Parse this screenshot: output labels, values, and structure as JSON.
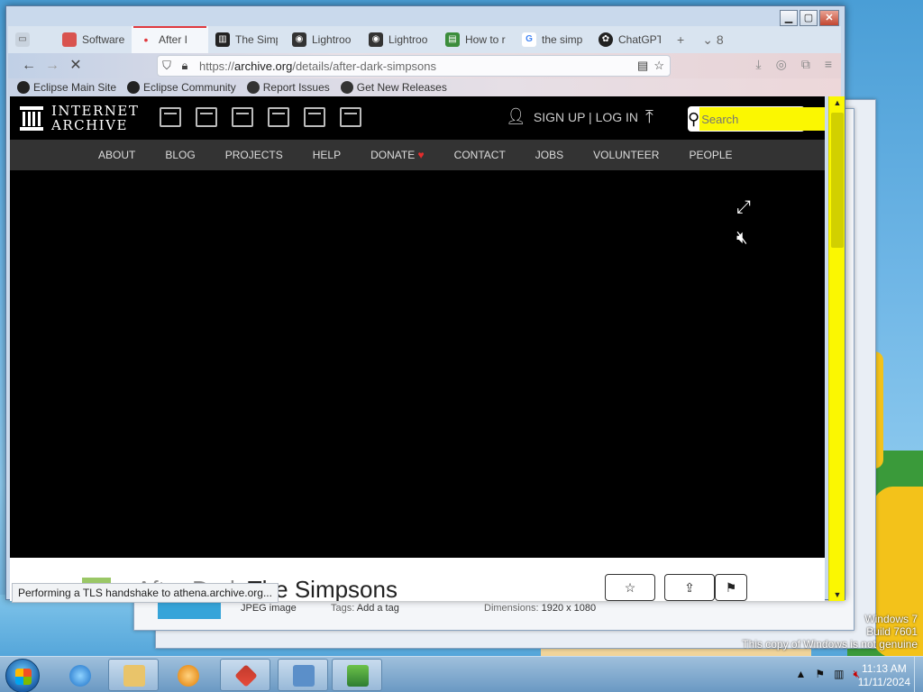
{
  "browser": {
    "tabs": [
      {
        "label": "Software",
        "color": "#d9534f",
        "icon": "colorful-grid-icon"
      },
      {
        "label": "After I",
        "color": "#e0393e",
        "icon": "dot-icon",
        "active": true
      },
      {
        "label": "The Simp",
        "color": "#222222",
        "icon": "archive-icon"
      },
      {
        "label": "Lightroo",
        "color": "#333333",
        "icon": "camera-icon"
      },
      {
        "label": "Lightroo",
        "color": "#333333",
        "icon": "camera-icon"
      },
      {
        "label": "How to r",
        "color": "#3c8d3c",
        "icon": "image-icon"
      },
      {
        "label": "the simp",
        "color": "#4285f4",
        "icon": "google-icon"
      },
      {
        "label": "ChatGPT",
        "color": "#222222",
        "icon": "chatgpt-icon"
      }
    ],
    "new_tab_glyph": "+",
    "tab_list_label": "8",
    "url_prefix": "https://",
    "url_domain": "archive.org",
    "url_path": "/details/after-dark-simpsons",
    "bookmarks": [
      "Eclipse Main Site",
      "Eclipse Community",
      "Report Issues",
      "Get New Releases"
    ],
    "status_text": "Performing a TLS handshake to athena.archive.org..."
  },
  "site": {
    "logo_line1": "INTERNET",
    "logo_line2": "ARCHIVE",
    "account_text": "SIGN UP | LOG IN",
    "search_placeholder": "Search",
    "nav": [
      "ABOUT",
      "BLOG",
      "PROJECTS",
      "HELP",
      "DONATE",
      "CONTACT",
      "JOBS",
      "VOLUNTEER",
      "PEOPLE"
    ],
    "donate_heart": "♥",
    "title_faint": "After Dark",
    "title_main": "The Simpsons"
  },
  "background_window": {
    "type_value": "JPEG image",
    "tags_key": "Tags:",
    "tags_value": "Add a tag",
    "dimensions_key": "Dimensions:",
    "dimensions_value": "1920 x 1080"
  },
  "desktop": {
    "watermark_line1": "Windows 7",
    "watermark_line2": "Build 7601",
    "watermark_line3": "This copy of Windows is not genuine"
  },
  "taskbar": {
    "time": "11:13 AM",
    "date": "11/11/2024"
  }
}
